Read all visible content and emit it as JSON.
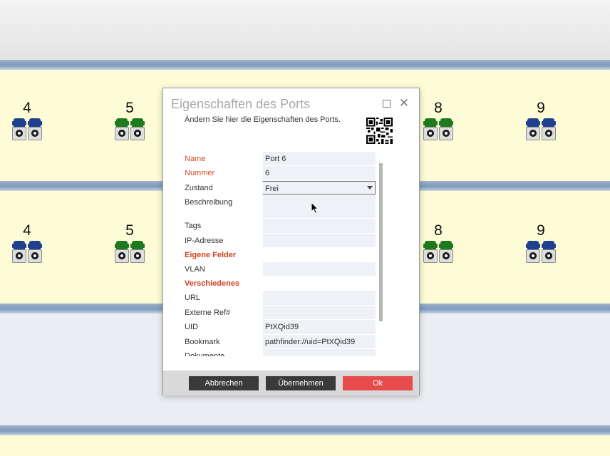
{
  "rack": {
    "rows": [
      {
        "groups": [
          {
            "number": "4",
            "color": "blue"
          },
          {
            "number": "5",
            "color": "green"
          },
          {
            "number": "8",
            "color": "green"
          },
          {
            "number": "9",
            "color": "blue"
          }
        ]
      },
      {
        "groups": [
          {
            "number": "4",
            "color": "blue"
          },
          {
            "number": "5",
            "color": "green"
          },
          {
            "number": "8",
            "color": "green"
          },
          {
            "number": "9",
            "color": "blue"
          }
        ]
      }
    ],
    "colors": {
      "blue": "#1f3f8f",
      "green": "#1d7a1d",
      "panel": "#fdfcd6"
    }
  },
  "dialog": {
    "title": "Eigenschaften des Ports",
    "subtitle": "Ändern Sie hier die Eigenschaften des Ports.",
    "icons": {
      "maximize": "maximize-icon",
      "close": "close-icon",
      "qr": "qr-code-icon"
    },
    "fields": {
      "name_label": "Name",
      "name_value": "Port 6",
      "nummer_label": "Nummer",
      "nummer_value": "6",
      "zustand_label": "Zustand",
      "zustand_value": "Frei",
      "beschreibung_label": "Beschreibung",
      "beschreibung_value": "",
      "tags_label": "Tags",
      "tags_value": "",
      "ip_label": "IP-Adresse",
      "ip_value": "",
      "cat_eigene": "Eigene Felder",
      "vlan_label": "VLAN",
      "vlan_value": "",
      "cat_verschiedenes": "Verschiedenes",
      "url_label": "URL",
      "url_value": "",
      "extref_label": "Externe Ref#",
      "extref_value": "",
      "uid_label": "UID",
      "uid_value": "PtXQid39",
      "bookmark_label": "Bookmark",
      "bookmark_value": "pathfinder://uid=PtXQid39",
      "dokumente_label": "Dokumente"
    },
    "buttons": {
      "cancel": "Abbrechen",
      "apply": "Übernehmen",
      "ok": "Ok"
    },
    "colors": {
      "accent_red": "#e84b4b",
      "label_red": "#d24a2e",
      "dark_button": "#3a3a3a"
    }
  }
}
